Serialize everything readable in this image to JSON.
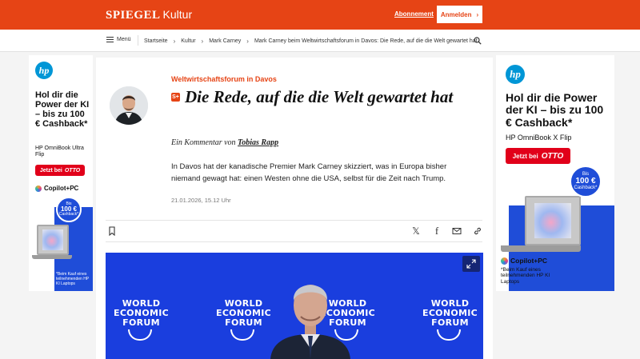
{
  "header": {
    "logo": "SPIEGEL",
    "section": "Kultur",
    "abo_label": "Abonnement",
    "login_label": "Anmelden",
    "brand_color": "#e64415"
  },
  "nav": {
    "menu_label": "Menü",
    "breadcrumbs": [
      "Startseite",
      "Kultur",
      "Mark Carney",
      "Mark Carney beim Weltwirtschaftsforum in Davos: Die Rede, auf die die Welt gewartet hat"
    ],
    "search_icon": "search-icon"
  },
  "ad_left": {
    "brand": "hp",
    "headline": "Hol dir die Power der KI – bis zu 100 € Cashback*",
    "product": "HP OmniBook Ultra Flip",
    "cta": "Jetzt bei",
    "shop": "OTTO",
    "copilot": "Copilot+PC",
    "badge_top": "Bis",
    "badge_amount": "100 €",
    "badge_bottom": "Cashback*",
    "fineprint": "*Beim Kauf eines teilnehmenden HP KI Laptops"
  },
  "ad_right": {
    "brand": "hp",
    "headline": "Hol dir die Power der KI – bis zu 100 € Cashback*",
    "product": "HP OmniBook X Flip",
    "cta": "Jetzt bei",
    "shop": "OTTO",
    "copilot": "Copilot+PC",
    "badge_top": "Bis",
    "badge_amount": "100 €",
    "badge_bottom": "Cashback*",
    "fineprint": "*Beim Kauf eines teilnehmenden HP KI Laptops"
  },
  "article": {
    "kicker": "Weltwirtschaftsforum in Davos",
    "plus_badge": "S+",
    "headline": "Die Rede, auf die die Welt gewartet hat",
    "byline_prefix": "Ein Kommentar von",
    "author": "Tobias Rapp",
    "teaser": "In Davos hat der kanadische Premier Mark Carney skizziert, was in Europa bisher niemand gewagt hat: einen Westen ohne die USA, selbst für die Zeit nach Trump.",
    "date": "21.01.2026, 15.12 Uhr"
  },
  "tools": {
    "bookmark_icon": "bookmark-icon",
    "share_x_glyph": "𝕏",
    "share_facebook_glyph": "f",
    "share_mail_icon": "mail-icon",
    "copy_link_icon": "link-icon"
  },
  "hero": {
    "wef_lines": [
      "WORLD",
      "ECONOMIC",
      "FORUM"
    ],
    "background": "#1a3ede"
  }
}
